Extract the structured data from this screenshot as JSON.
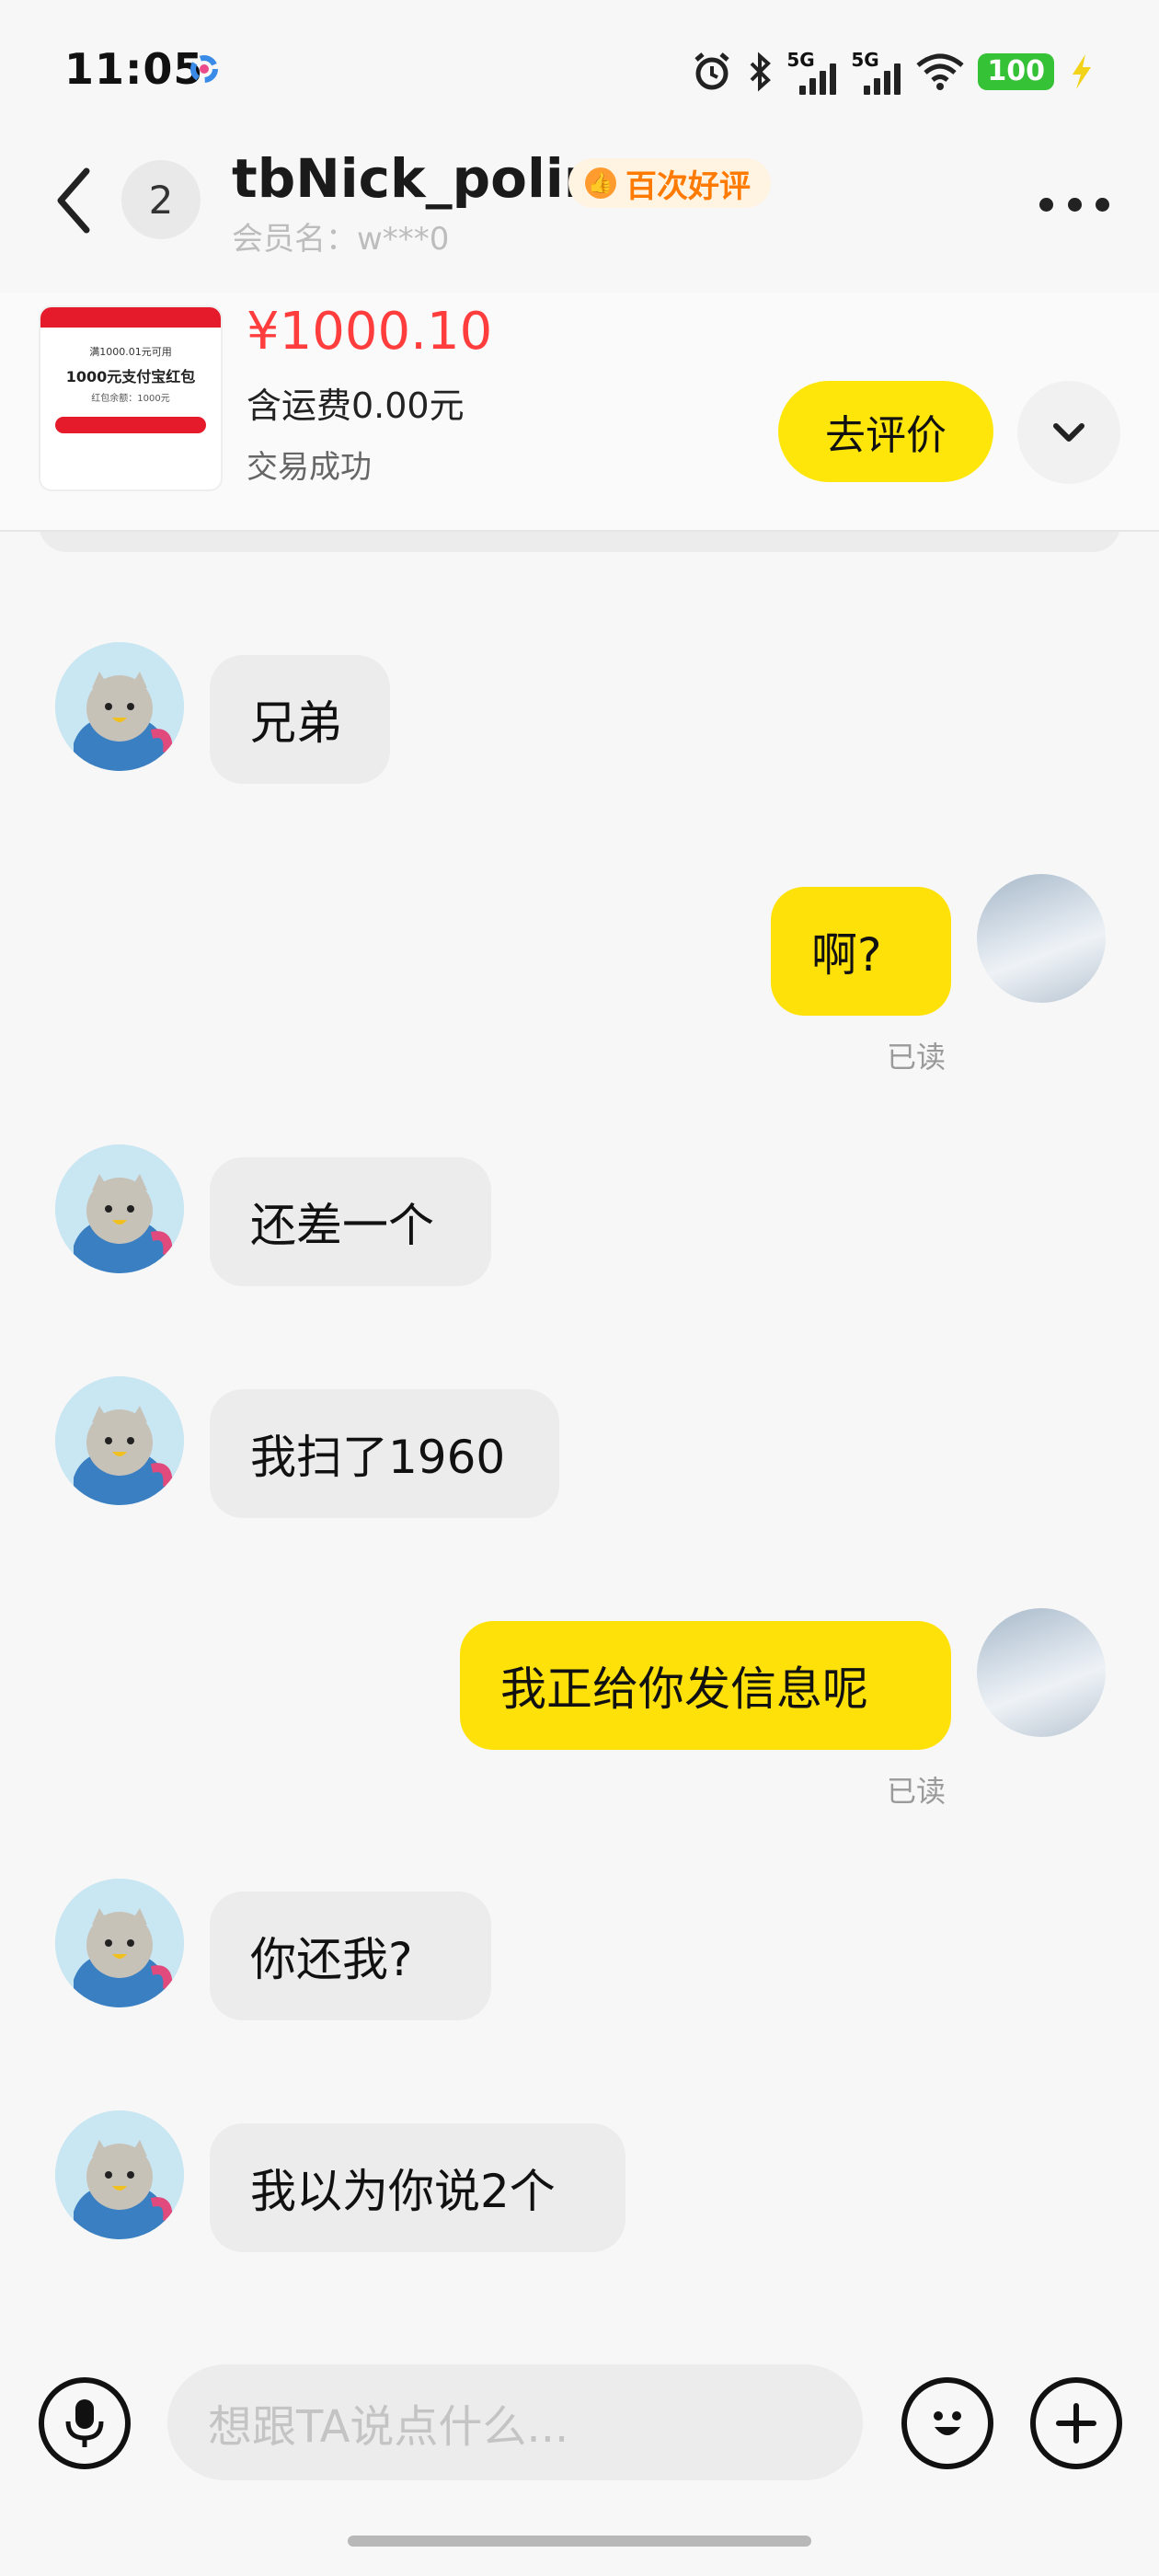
{
  "status_bar": {
    "time": "11:05",
    "network_1": "5G",
    "network_2": "5G",
    "battery": "100"
  },
  "header": {
    "unread_count": "2",
    "nickname": "tbNick_polir",
    "badge": "百次好评",
    "member_label": "会员名：w***0"
  },
  "order": {
    "thumb_line1": "满1000.01元可用",
    "thumb_line2": "1000元支付宝红包",
    "thumb_line3": "红包余额：1000元",
    "price": "¥1000.10",
    "shipping": "含运费0.00元",
    "status": "交易成功",
    "review_button": "去评价"
  },
  "messages": [
    {
      "side": "in",
      "text": "兄弟"
    },
    {
      "side": "out",
      "text": "啊?",
      "read": "已读"
    },
    {
      "side": "in",
      "text": "还差一个"
    },
    {
      "side": "in",
      "text": "我扫了1960"
    },
    {
      "side": "out",
      "text": "我正给你发信息呢",
      "read": "已读"
    },
    {
      "side": "in",
      "text": "你还我?"
    },
    {
      "side": "in",
      "text": "我以为你说2个"
    }
  ],
  "input": {
    "placeholder": "想跟TA说点什么..."
  },
  "colors": {
    "accent_yellow": "#ffe10a",
    "price_red": "#ff3d3d",
    "badge_orange": "#ff7a00",
    "battery_green": "#36c236"
  }
}
